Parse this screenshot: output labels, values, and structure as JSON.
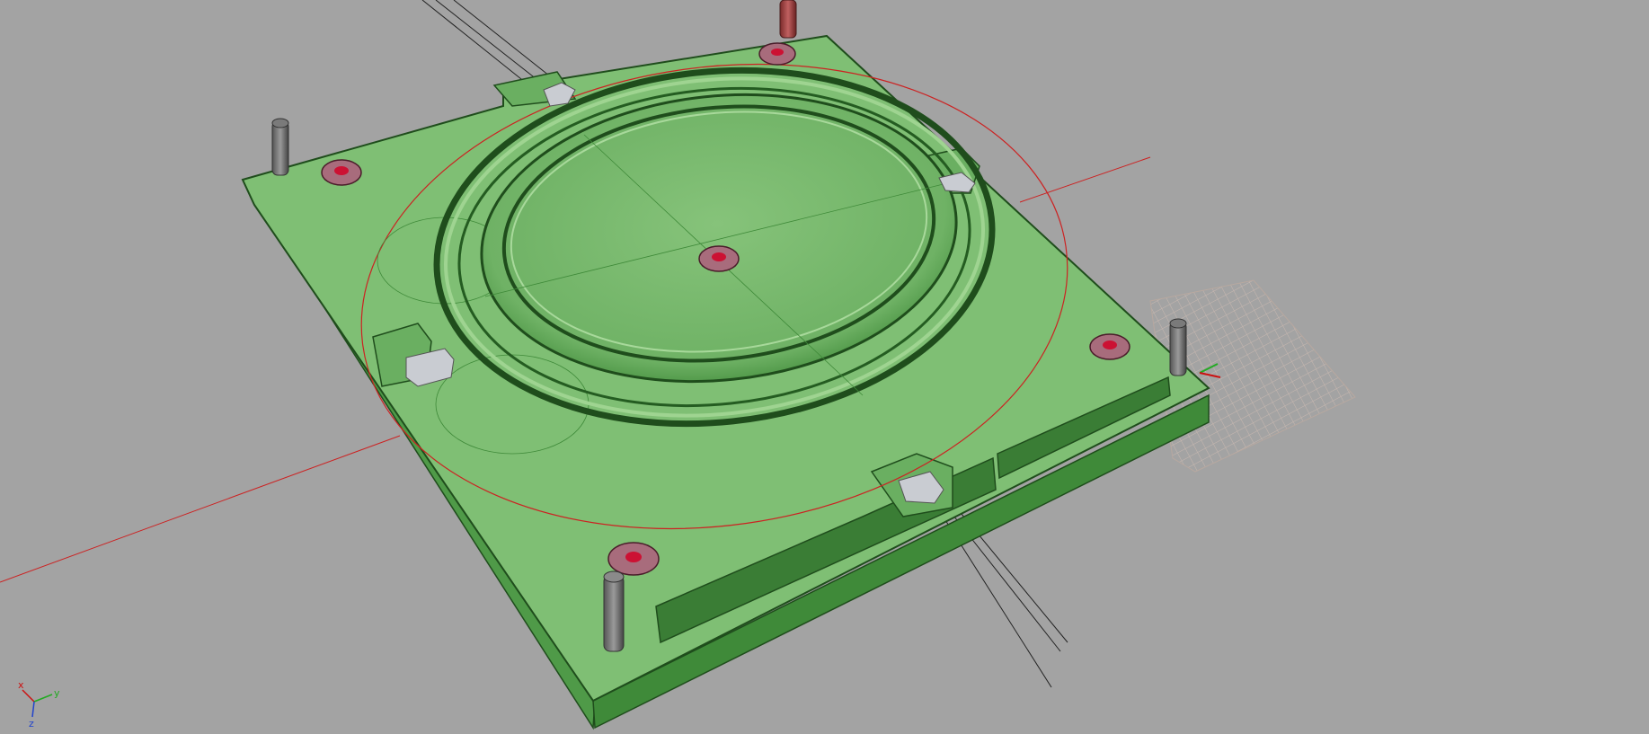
{
  "viewport": {
    "name": "3d-model-viewport",
    "background": "#a3a3a3"
  },
  "model": {
    "name": "mold-plate",
    "color_face": "#7fbf74",
    "color_side": "#4f9a48",
    "color_edge": "#1f4d1c",
    "color_dark": "#2f6b2b"
  },
  "axis": {
    "x_label": "x",
    "y_label": "y",
    "z_label": "z",
    "x_color": "#cc1111",
    "y_color": "#22aa22",
    "z_color": "#2244cc"
  },
  "overlays": {
    "construction_circle_color": "#cc2222",
    "grid_color": "#c8b8b0"
  }
}
